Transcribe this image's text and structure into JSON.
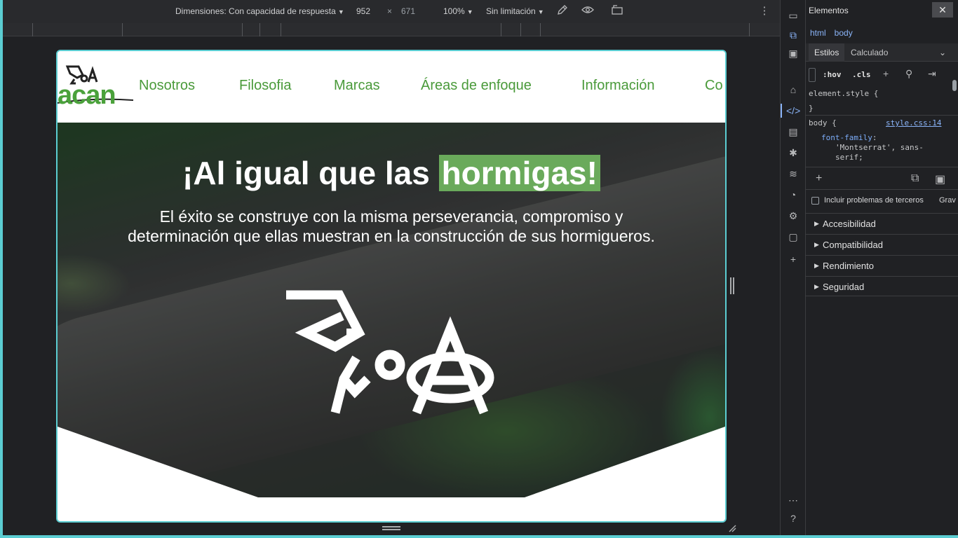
{
  "device_toolbar": {
    "dimensions_label": "Dimensiones: Con capacidad de respuesta",
    "width": "952",
    "times": "×",
    "height": "671",
    "zoom": "100%",
    "throttling": "Sin limitación",
    "icons": [
      "eyedropper-icon",
      "eye-icon",
      "rotate-icon",
      "more-vert-icon"
    ]
  },
  "page": {
    "logo_text": "acan",
    "nav": [
      "Nosotros",
      "Filosofia",
      "Marcas",
      "Áreas de enfoque",
      "Información",
      "Co"
    ],
    "hero": {
      "title_before": "¡Al igual que las ",
      "title_highlight": "hormigas!",
      "subtitle": "El éxito se construye con la misma perseverancia, compromiso y determinación que ellas muestran en la construcción de sus hormigueros."
    }
  },
  "devtools": {
    "title": "Elementos",
    "close": "✕",
    "breadcrumbs": [
      "html",
      "body"
    ],
    "tabs": {
      "styles": "Estilos",
      "computed": "Calculado"
    },
    "filter": {
      "hov": ":hov",
      "cls": ".cls"
    },
    "styles": {
      "element_style_open": "element.style {",
      "element_style_close": "}",
      "body_selector": "body {",
      "body_source": "style.css:14",
      "prop_name": "font-family",
      "prop_colon": ":",
      "prop_value_1": "'Montserrat', sans-",
      "prop_value_2": "serif;"
    },
    "issues": {
      "third_party": "Incluir problemas de terceros",
      "severity": "Grav"
    },
    "categories": [
      "Accesibilidad",
      "Compatibilidad",
      "Rendimiento",
      "Seguridad"
    ]
  },
  "colors": {
    "brand_green": "#4aa13b",
    "highlight_green": "#6aaa5b",
    "frame_teal": "#5bcdd2",
    "devtools_bg": "#202124",
    "link_blue": "#8ab4f8"
  }
}
